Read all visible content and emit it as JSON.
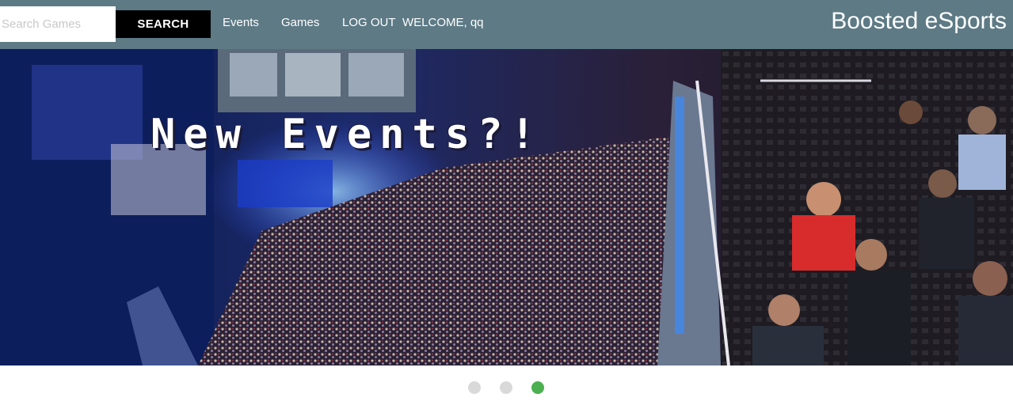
{
  "navbar": {
    "search": {
      "placeholder": "Search Games",
      "value": ""
    },
    "search_button_label": "SEARCH",
    "links": [
      {
        "label": "Events"
      },
      {
        "label": "Games"
      },
      {
        "label": "LOG OUT"
      }
    ],
    "welcome_text": "WELCOME, qq",
    "brand": "Boosted eSports"
  },
  "carousel": {
    "slide_title": "New Events?!",
    "slide_count": 3,
    "active_index": 2,
    "colors": {
      "active_dot": "#4caf50",
      "inactive_dot": "#d9d9d9",
      "navbar": "#5d7a85"
    }
  }
}
